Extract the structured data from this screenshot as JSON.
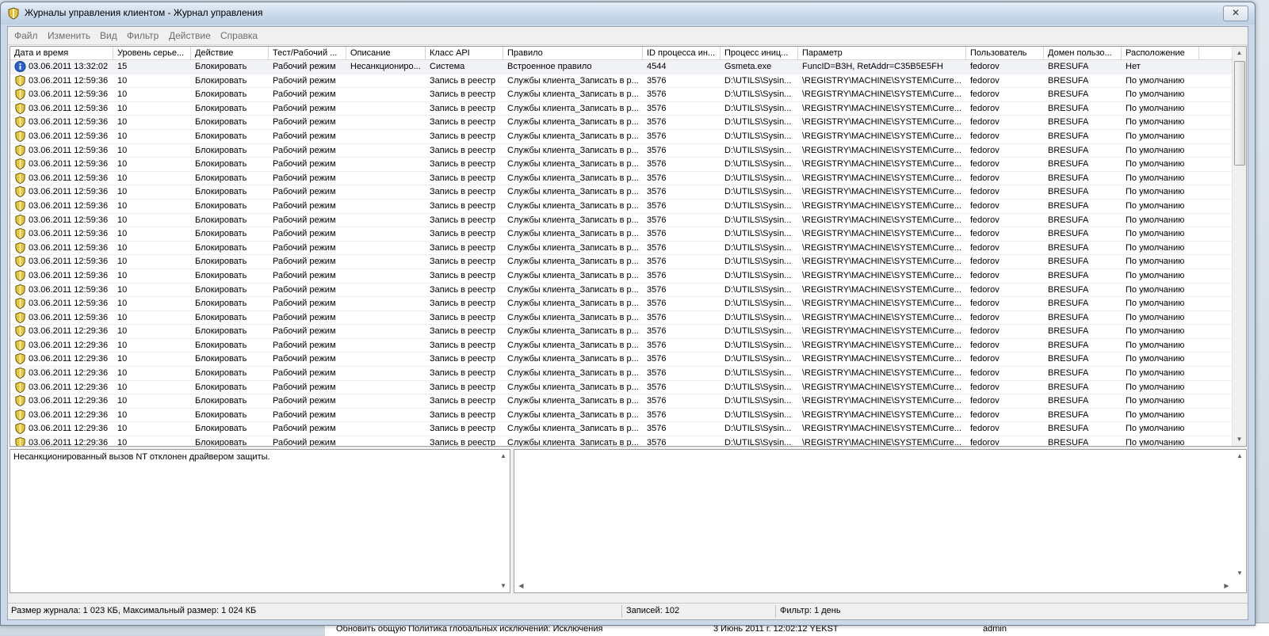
{
  "window": {
    "title": "Журналы управления клиентом - Журнал управления",
    "close_glyph": "✕"
  },
  "menu": [
    "Файл",
    "Изменить",
    "Вид",
    "Фильтр",
    "Действие",
    "Справка"
  ],
  "columns": [
    "Дата и время",
    "Уровень серье...",
    "Действие",
    "Тест/Рабочий ...",
    "Описание",
    "Класс API",
    "Правило",
    "ID процесса ин...",
    "Процесс иниц...",
    "Параметр",
    "Пользователь",
    "Домен пользо...",
    "Расположение"
  ],
  "rows": [
    {
      "icon": "info",
      "cells": [
        "03.06.2011 13:32:02",
        "15",
        "Блокировать",
        "Рабочий режим",
        "Несанкциониро...",
        "Система",
        "Встроенное правило",
        "4544",
        "Gsmeta.exe",
        "FuncID=B3H, RetAddr=C35B5E5FH",
        "fedorov",
        "BRESUFA",
        "Нет"
      ]
    },
    {
      "icon": "shield",
      "cells": [
        "03.06.2011 12:59:36",
        "10",
        "Блокировать",
        "Рабочий режим",
        "",
        "Запись в реестр",
        "Службы клиента_Записать в р...",
        "3576",
        "D:\\UTILS\\Sysin...",
        "\\REGISTRY\\MACHINE\\SYSTEM\\Curre...",
        "fedorov",
        "BRESUFA",
        "По умолчанию"
      ]
    },
    {
      "icon": "shield",
      "cells": [
        "03.06.2011 12:59:36",
        "10",
        "Блокировать",
        "Рабочий режим",
        "",
        "Запись в реестр",
        "Службы клиента_Записать в р...",
        "3576",
        "D:\\UTILS\\Sysin...",
        "\\REGISTRY\\MACHINE\\SYSTEM\\Curre...",
        "fedorov",
        "BRESUFA",
        "По умолчанию"
      ]
    },
    {
      "icon": "shield",
      "cells": [
        "03.06.2011 12:59:36",
        "10",
        "Блокировать",
        "Рабочий режим",
        "",
        "Запись в реестр",
        "Службы клиента_Записать в р...",
        "3576",
        "D:\\UTILS\\Sysin...",
        "\\REGISTRY\\MACHINE\\SYSTEM\\Curre...",
        "fedorov",
        "BRESUFA",
        "По умолчанию"
      ]
    },
    {
      "icon": "shield",
      "cells": [
        "03.06.2011 12:59:36",
        "10",
        "Блокировать",
        "Рабочий режим",
        "",
        "Запись в реестр",
        "Службы клиента_Записать в р...",
        "3576",
        "D:\\UTILS\\Sysin...",
        "\\REGISTRY\\MACHINE\\SYSTEM\\Curre...",
        "fedorov",
        "BRESUFA",
        "По умолчанию"
      ]
    },
    {
      "icon": "shield",
      "cells": [
        "03.06.2011 12:59:36",
        "10",
        "Блокировать",
        "Рабочий режим",
        "",
        "Запись в реестр",
        "Службы клиента_Записать в р...",
        "3576",
        "D:\\UTILS\\Sysin...",
        "\\REGISTRY\\MACHINE\\SYSTEM\\Curre...",
        "fedorov",
        "BRESUFA",
        "По умолчанию"
      ]
    },
    {
      "icon": "shield",
      "cells": [
        "03.06.2011 12:59:36",
        "10",
        "Блокировать",
        "Рабочий режим",
        "",
        "Запись в реестр",
        "Службы клиента_Записать в р...",
        "3576",
        "D:\\UTILS\\Sysin...",
        "\\REGISTRY\\MACHINE\\SYSTEM\\Curre...",
        "fedorov",
        "BRESUFA",
        "По умолчанию"
      ]
    },
    {
      "icon": "shield",
      "cells": [
        "03.06.2011 12:59:36",
        "10",
        "Блокировать",
        "Рабочий режим",
        "",
        "Запись в реестр",
        "Службы клиента_Записать в р...",
        "3576",
        "D:\\UTILS\\Sysin...",
        "\\REGISTRY\\MACHINE\\SYSTEM\\Curre...",
        "fedorov",
        "BRESUFA",
        "По умолчанию"
      ]
    },
    {
      "icon": "shield",
      "cells": [
        "03.06.2011 12:59:36",
        "10",
        "Блокировать",
        "Рабочий режим",
        "",
        "Запись в реестр",
        "Службы клиента_Записать в р...",
        "3576",
        "D:\\UTILS\\Sysin...",
        "\\REGISTRY\\MACHINE\\SYSTEM\\Curre...",
        "fedorov",
        "BRESUFA",
        "По умолчанию"
      ]
    },
    {
      "icon": "shield",
      "cells": [
        "03.06.2011 12:59:36",
        "10",
        "Блокировать",
        "Рабочий режим",
        "",
        "Запись в реестр",
        "Службы клиента_Записать в р...",
        "3576",
        "D:\\UTILS\\Sysin...",
        "\\REGISTRY\\MACHINE\\SYSTEM\\Curre...",
        "fedorov",
        "BRESUFA",
        "По умолчанию"
      ]
    },
    {
      "icon": "shield",
      "cells": [
        "03.06.2011 12:59:36",
        "10",
        "Блокировать",
        "Рабочий режим",
        "",
        "Запись в реестр",
        "Службы клиента_Записать в р...",
        "3576",
        "D:\\UTILS\\Sysin...",
        "\\REGISTRY\\MACHINE\\SYSTEM\\Curre...",
        "fedorov",
        "BRESUFA",
        "По умолчанию"
      ]
    },
    {
      "icon": "shield",
      "cells": [
        "03.06.2011 12:59:36",
        "10",
        "Блокировать",
        "Рабочий режим",
        "",
        "Запись в реестр",
        "Службы клиента_Записать в р...",
        "3576",
        "D:\\UTILS\\Sysin...",
        "\\REGISTRY\\MACHINE\\SYSTEM\\Curre...",
        "fedorov",
        "BRESUFA",
        "По умолчанию"
      ]
    },
    {
      "icon": "shield",
      "cells": [
        "03.06.2011 12:59:36",
        "10",
        "Блокировать",
        "Рабочий режим",
        "",
        "Запись в реестр",
        "Службы клиента_Записать в р...",
        "3576",
        "D:\\UTILS\\Sysin...",
        "\\REGISTRY\\MACHINE\\SYSTEM\\Curre...",
        "fedorov",
        "BRESUFA",
        "По умолчанию"
      ]
    },
    {
      "icon": "shield",
      "cells": [
        "03.06.2011 12:59:36",
        "10",
        "Блокировать",
        "Рабочий режим",
        "",
        "Запись в реестр",
        "Службы клиента_Записать в р...",
        "3576",
        "D:\\UTILS\\Sysin...",
        "\\REGISTRY\\MACHINE\\SYSTEM\\Curre...",
        "fedorov",
        "BRESUFA",
        "По умолчанию"
      ]
    },
    {
      "icon": "shield",
      "cells": [
        "03.06.2011 12:59:36",
        "10",
        "Блокировать",
        "Рабочий режим",
        "",
        "Запись в реестр",
        "Службы клиента_Записать в р...",
        "3576",
        "D:\\UTILS\\Sysin...",
        "\\REGISTRY\\MACHINE\\SYSTEM\\Curre...",
        "fedorov",
        "BRESUFA",
        "По умолчанию"
      ]
    },
    {
      "icon": "shield",
      "cells": [
        "03.06.2011 12:59:36",
        "10",
        "Блокировать",
        "Рабочий режим",
        "",
        "Запись в реестр",
        "Службы клиента_Записать в р...",
        "3576",
        "D:\\UTILS\\Sysin...",
        "\\REGISTRY\\MACHINE\\SYSTEM\\Curre...",
        "fedorov",
        "BRESUFA",
        "По умолчанию"
      ]
    },
    {
      "icon": "shield",
      "cells": [
        "03.06.2011 12:59:36",
        "10",
        "Блокировать",
        "Рабочий режим",
        "",
        "Запись в реестр",
        "Службы клиента_Записать в р...",
        "3576",
        "D:\\UTILS\\Sysin...",
        "\\REGISTRY\\MACHINE\\SYSTEM\\Curre...",
        "fedorov",
        "BRESUFA",
        "По умолчанию"
      ]
    },
    {
      "icon": "shield",
      "cells": [
        "03.06.2011 12:59:36",
        "10",
        "Блокировать",
        "Рабочий режим",
        "",
        "Запись в реестр",
        "Службы клиента_Записать в р...",
        "3576",
        "D:\\UTILS\\Sysin...",
        "\\REGISTRY\\MACHINE\\SYSTEM\\Curre...",
        "fedorov",
        "BRESUFA",
        "По умолчанию"
      ]
    },
    {
      "icon": "shield",
      "cells": [
        "03.06.2011 12:59:36",
        "10",
        "Блокировать",
        "Рабочий режим",
        "",
        "Запись в реестр",
        "Службы клиента_Записать в р...",
        "3576",
        "D:\\UTILS\\Sysin...",
        "\\REGISTRY\\MACHINE\\SYSTEM\\Curre...",
        "fedorov",
        "BRESUFA",
        "По умолчанию"
      ]
    },
    {
      "icon": "shield",
      "cells": [
        "03.06.2011 12:29:36",
        "10",
        "Блокировать",
        "Рабочий режим",
        "",
        "Запись в реестр",
        "Службы клиента_Записать в р...",
        "3576",
        "D:\\UTILS\\Sysin...",
        "\\REGISTRY\\MACHINE\\SYSTEM\\Curre...",
        "fedorov",
        "BRESUFA",
        "По умолчанию"
      ]
    },
    {
      "icon": "shield",
      "cells": [
        "03.06.2011 12:29:36",
        "10",
        "Блокировать",
        "Рабочий режим",
        "",
        "Запись в реестр",
        "Службы клиента_Записать в р...",
        "3576",
        "D:\\UTILS\\Sysin...",
        "\\REGISTRY\\MACHINE\\SYSTEM\\Curre...",
        "fedorov",
        "BRESUFA",
        "По умолчанию"
      ]
    },
    {
      "icon": "shield",
      "cells": [
        "03.06.2011 12:29:36",
        "10",
        "Блокировать",
        "Рабочий режим",
        "",
        "Запись в реестр",
        "Службы клиента_Записать в р...",
        "3576",
        "D:\\UTILS\\Sysin...",
        "\\REGISTRY\\MACHINE\\SYSTEM\\Curre...",
        "fedorov",
        "BRESUFA",
        "По умолчанию"
      ]
    },
    {
      "icon": "shield",
      "cells": [
        "03.06.2011 12:29:36",
        "10",
        "Блокировать",
        "Рабочий режим",
        "",
        "Запись в реестр",
        "Службы клиента_Записать в р...",
        "3576",
        "D:\\UTILS\\Sysin...",
        "\\REGISTRY\\MACHINE\\SYSTEM\\Curre...",
        "fedorov",
        "BRESUFA",
        "По умолчанию"
      ]
    },
    {
      "icon": "shield",
      "cells": [
        "03.06.2011 12:29:36",
        "10",
        "Блокировать",
        "Рабочий режим",
        "",
        "Запись в реестр",
        "Службы клиента_Записать в р...",
        "3576",
        "D:\\UTILS\\Sysin...",
        "\\REGISTRY\\MACHINE\\SYSTEM\\Curre...",
        "fedorov",
        "BRESUFA",
        "По умолчанию"
      ]
    },
    {
      "icon": "shield",
      "cells": [
        "03.06.2011 12:29:36",
        "10",
        "Блокировать",
        "Рабочий режим",
        "",
        "Запись в реестр",
        "Службы клиента_Записать в р...",
        "3576",
        "D:\\UTILS\\Sysin...",
        "\\REGISTRY\\MACHINE\\SYSTEM\\Curre...",
        "fedorov",
        "BRESUFA",
        "По умолчанию"
      ]
    },
    {
      "icon": "shield",
      "cells": [
        "03.06.2011 12:29:36",
        "10",
        "Блокировать",
        "Рабочий режим",
        "",
        "Запись в реестр",
        "Службы клиента_Записать в р...",
        "3576",
        "D:\\UTILS\\Sysin...",
        "\\REGISTRY\\MACHINE\\SYSTEM\\Curre...",
        "fedorov",
        "BRESUFA",
        "По умолчанию"
      ]
    },
    {
      "icon": "shield",
      "cells": [
        "03.06.2011 12:29:36",
        "10",
        "Блокировать",
        "Рабочий режим",
        "",
        "Запись в реестр",
        "Службы клиента_Записать в р...",
        "3576",
        "D:\\UTILS\\Sysin...",
        "\\REGISTRY\\MACHINE\\SYSTEM\\Curre...",
        "fedorov",
        "BRESUFA",
        "По умолчанию"
      ]
    },
    {
      "icon": "shield",
      "cells": [
        "03.06.2011 12:29:36",
        "10",
        "Блокировать",
        "Рабочий режим",
        "",
        "Запись в реестр",
        "Службы клиента_Записать в р...",
        "3576",
        "D:\\UTILS\\Sysin...",
        "\\REGISTRY\\MACHINE\\SYSTEM\\Curre...",
        "fedorov",
        "BRESUFA",
        "По умолчанию"
      ]
    },
    {
      "icon": "shield",
      "cells": [
        "03.06.2011 12:29:36",
        "10",
        "Блокировать",
        "Рабочий режим",
        "",
        "Запись в реестр",
        "Службы клиента_Записать в р...",
        "3576",
        "D:\\UTILS\\Sysin...",
        "\\REGISTRY\\MACHINE\\SYSTEM\\Curre...",
        "fedorov",
        "BRESUFA",
        "По умолчанию"
      ]
    }
  ],
  "details": {
    "text": "Несанкционированный вызов NT отклонен драйвером защиты."
  },
  "statusbar": {
    "size": "Размер журнала: 1 023 КБ, Максимальный размер: 1 024 КБ",
    "records": "Записей: 102",
    "filter": "Фильтр: 1 день"
  },
  "background": {
    "strip": [
      "Обновить общую Политика глобальных исключений: Исключения",
      "3 Июнь 2011 г. 12:02:12 YEKST",
      "admin"
    ]
  }
}
